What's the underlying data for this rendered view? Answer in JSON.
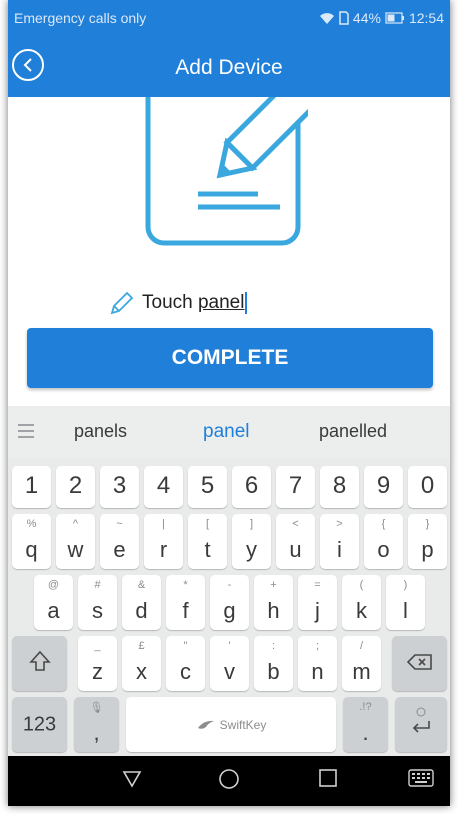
{
  "status_bar": {
    "carrier_text": "Emergency calls only",
    "battery_percent": "44%",
    "time": "12:54"
  },
  "header": {
    "title": "Add Device"
  },
  "device_name": {
    "prefix": "Touch ",
    "underlined_word": "panel"
  },
  "complete_button": {
    "label": "COMPLETE"
  },
  "suggestions": [
    "panels",
    "panel",
    "panelled"
  ],
  "keyboard": {
    "number_row": [
      "1",
      "2",
      "3",
      "4",
      "5",
      "6",
      "7",
      "8",
      "9",
      "0"
    ],
    "row1": [
      {
        "main": "q",
        "sec": "%"
      },
      {
        "main": "w",
        "sec": "^"
      },
      {
        "main": "e",
        "sec": "~"
      },
      {
        "main": "r",
        "sec": "|"
      },
      {
        "main": "t",
        "sec": "["
      },
      {
        "main": "y",
        "sec": "]"
      },
      {
        "main": "u",
        "sec": "<"
      },
      {
        "main": "i",
        "sec": ">"
      },
      {
        "main": "o",
        "sec": "{"
      },
      {
        "main": "p",
        "sec": "}"
      }
    ],
    "row2": [
      {
        "main": "a",
        "sec": "@"
      },
      {
        "main": "s",
        "sec": "#"
      },
      {
        "main": "d",
        "sec": "&"
      },
      {
        "main": "f",
        "sec": "*"
      },
      {
        "main": "g",
        "sec": "-"
      },
      {
        "main": "h",
        "sec": "+"
      },
      {
        "main": "j",
        "sec": "="
      },
      {
        "main": "k",
        "sec": "("
      },
      {
        "main": "l",
        "sec": ")"
      }
    ],
    "row3": [
      {
        "main": "z",
        "sec": "_"
      },
      {
        "main": "x",
        "sec": "£"
      },
      {
        "main": "c",
        "sec": "\""
      },
      {
        "main": "v",
        "sec": "'"
      },
      {
        "main": "b",
        "sec": ":"
      },
      {
        "main": "n",
        "sec": ";"
      },
      {
        "main": "m",
        "sec": "/"
      }
    ],
    "numbers_key": "123",
    "comma_key": {
      "main": ",",
      "sec": "🎙"
    },
    "space_brand": "SwiftKey",
    "period_key": {
      "main": ".",
      "sec": ".!?"
    }
  },
  "colors": {
    "primary": "#1f7fd9",
    "keyboard_bg": "#e9eaea",
    "key_bg": "#ffffff",
    "key_dark": "#cdd0d2"
  }
}
